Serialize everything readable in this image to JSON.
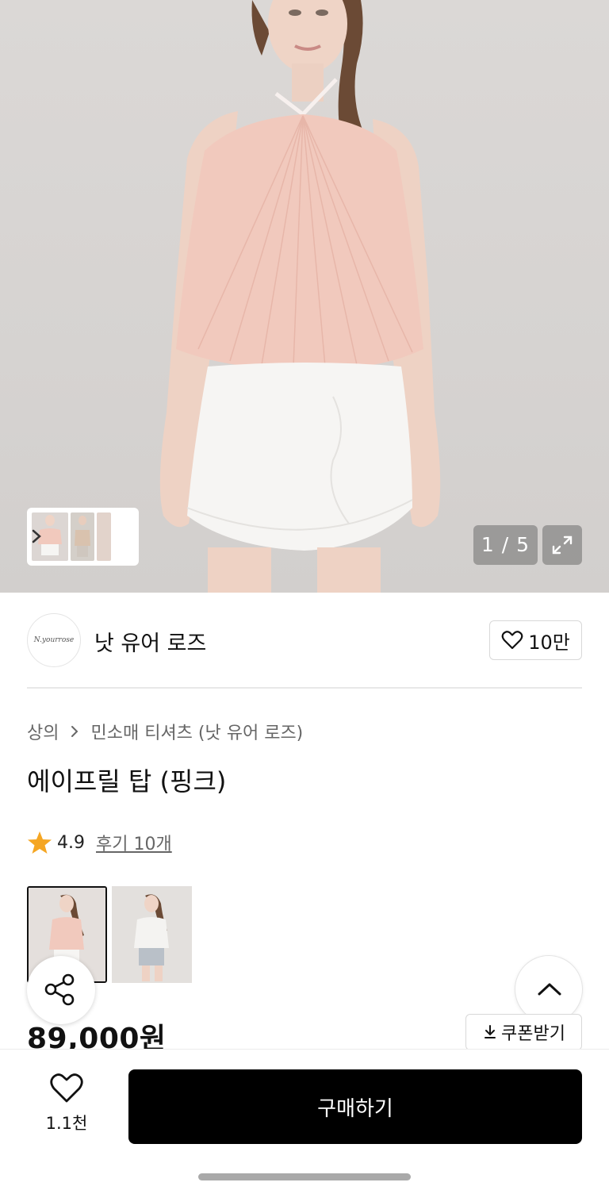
{
  "gallery": {
    "counter": "1 / 5"
  },
  "brand": {
    "logo_text": "N.yourrose",
    "name": "낫 유어 로즈",
    "like_count": "10만"
  },
  "breadcrumb": {
    "category": "상의",
    "subcategory": "민소매 티셔츠 (낫 유어 로즈)"
  },
  "product": {
    "title": "에이프릴 탑 (핑크)",
    "rating": "4.9",
    "reviews": "후기 10개",
    "price": "89,000원"
  },
  "coupon": {
    "label": "쿠폰받기"
  },
  "bottom_bar": {
    "wish_count": "1.1천",
    "buy_label": "구매하기"
  },
  "colors": {
    "accent_star": "#f5a623",
    "buy_button": "#000000",
    "top_pink": "#f1c9bd"
  }
}
